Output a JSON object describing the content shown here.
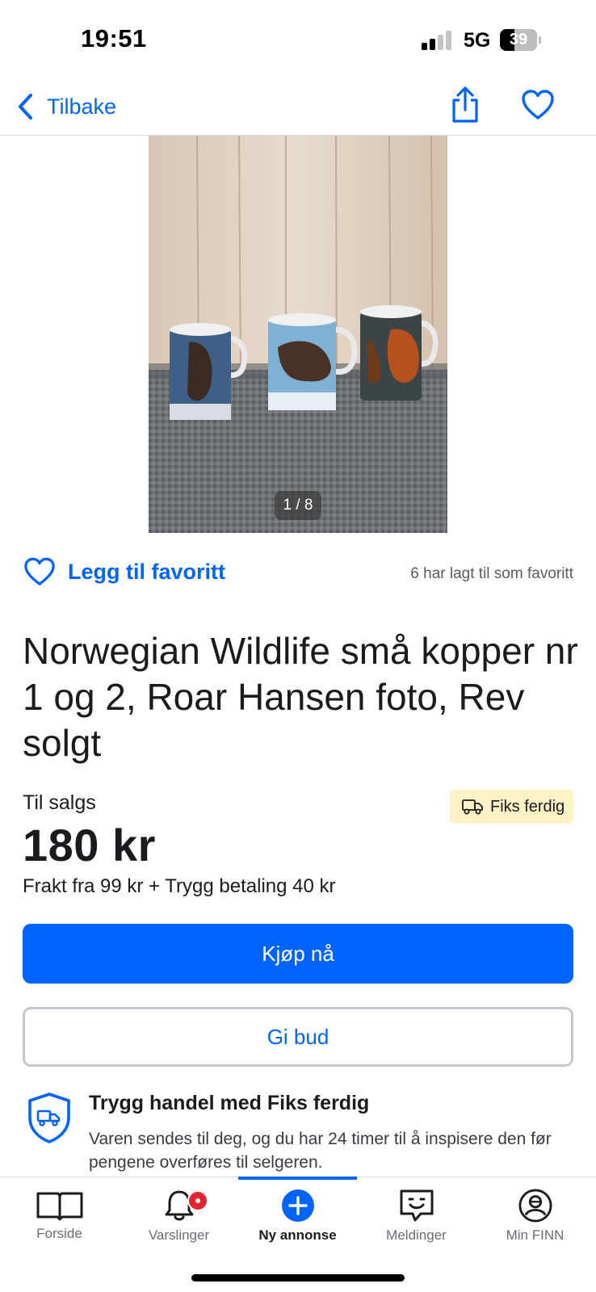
{
  "status_bar": {
    "time": "19:51",
    "network": "5G",
    "battery": "39"
  },
  "nav": {
    "back_label": "Tilbake",
    "share_icon": "share-icon",
    "favorite_icon": "heart-outline-icon"
  },
  "gallery": {
    "counter": "1 / 8"
  },
  "favorite": {
    "label": "Legg til favoritt",
    "count_text": "6 har lagt til som favoritt"
  },
  "listing": {
    "title": "Norwegian Wildlife små kopper nr 1 og 2, Roar Hansen foto, Rev solgt",
    "status": "Til salgs",
    "badge": "Fiks ferdig",
    "price": "180 kr",
    "shipping": "Frakt fra 99 kr + Trygg betaling 40 kr"
  },
  "actions": {
    "buy_label": "Kjøp nå",
    "bid_label": "Gi bud"
  },
  "safe_trade": {
    "title": "Trygg handel med Fiks ferdig",
    "text": "Varen sendes til deg, og du har 24 timer til å inspisere den før pengene overføres til selgeren."
  },
  "tabs": [
    {
      "label": "Forside",
      "icon": "book-icon"
    },
    {
      "label": "Varslinger",
      "icon": "bell-icon"
    },
    {
      "label": "Ny annonse",
      "icon": "plus-circle-icon",
      "active": true
    },
    {
      "label": "Meldinger",
      "icon": "chat-icon"
    },
    {
      "label": "Min FINN",
      "icon": "profile-icon"
    }
  ],
  "colors": {
    "accent": "#0063fb",
    "badge_bg": "#fdf3c6",
    "notification": "#e3232e"
  }
}
